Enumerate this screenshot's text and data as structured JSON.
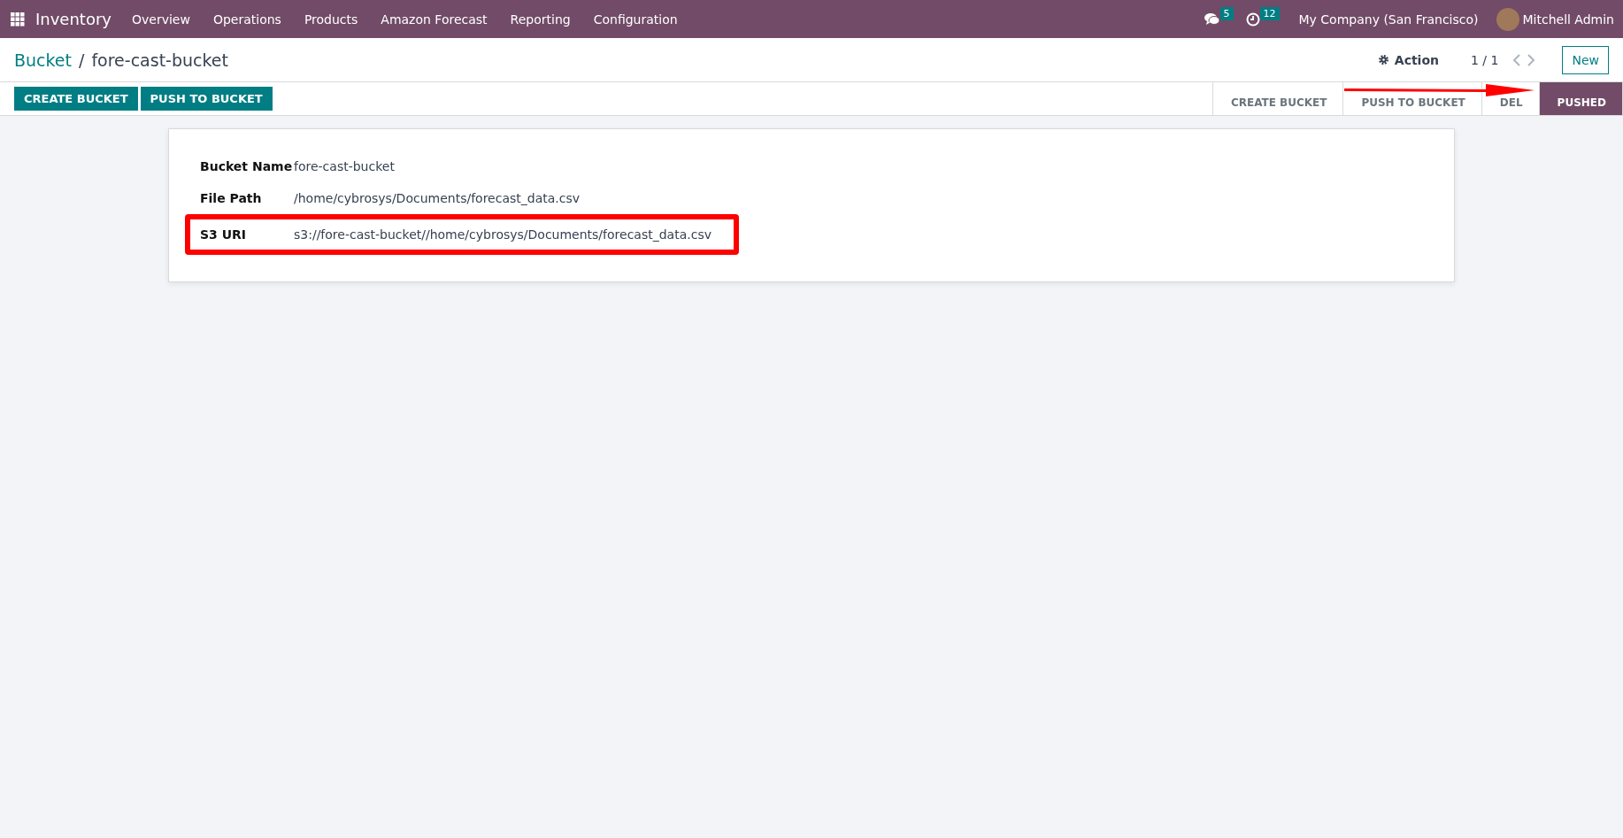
{
  "navbar": {
    "app_name": "Inventory",
    "menu": [
      "Overview",
      "Operations",
      "Products",
      "Amazon Forecast",
      "Reporting",
      "Configuration"
    ],
    "messages_count": "5",
    "activities_count": "12",
    "company": "My Company (San Francisco)",
    "user": "Mitchell Admin"
  },
  "breadcrumb": {
    "parent": "Bucket",
    "separator": "/",
    "current": "fore-cast-bucket"
  },
  "control_panel": {
    "action": "Action",
    "pager": "1 / 1",
    "new_button": "New"
  },
  "header_buttons": [
    "CREATE BUCKET",
    "PUSH TO BUCKET"
  ],
  "status_stages": [
    {
      "label": "CREATE BUCKET",
      "selected": false
    },
    {
      "label": "PUSH TO BUCKET",
      "selected": false
    },
    {
      "label": "DEL",
      "selected": false
    },
    {
      "label": "PUSHED",
      "selected": true
    }
  ],
  "fields": [
    {
      "label": "Bucket Name",
      "value": "fore-cast-bucket",
      "highlighted": false
    },
    {
      "label": "File Path",
      "value": "/home/cybrosys/Documents/forecast_data.csv",
      "highlighted": false
    },
    {
      "label": "S3 URI",
      "value": "s3://fore-cast-bucket//home/cybrosys/Documents/forecast_data.csv",
      "highlighted": true
    }
  ]
}
